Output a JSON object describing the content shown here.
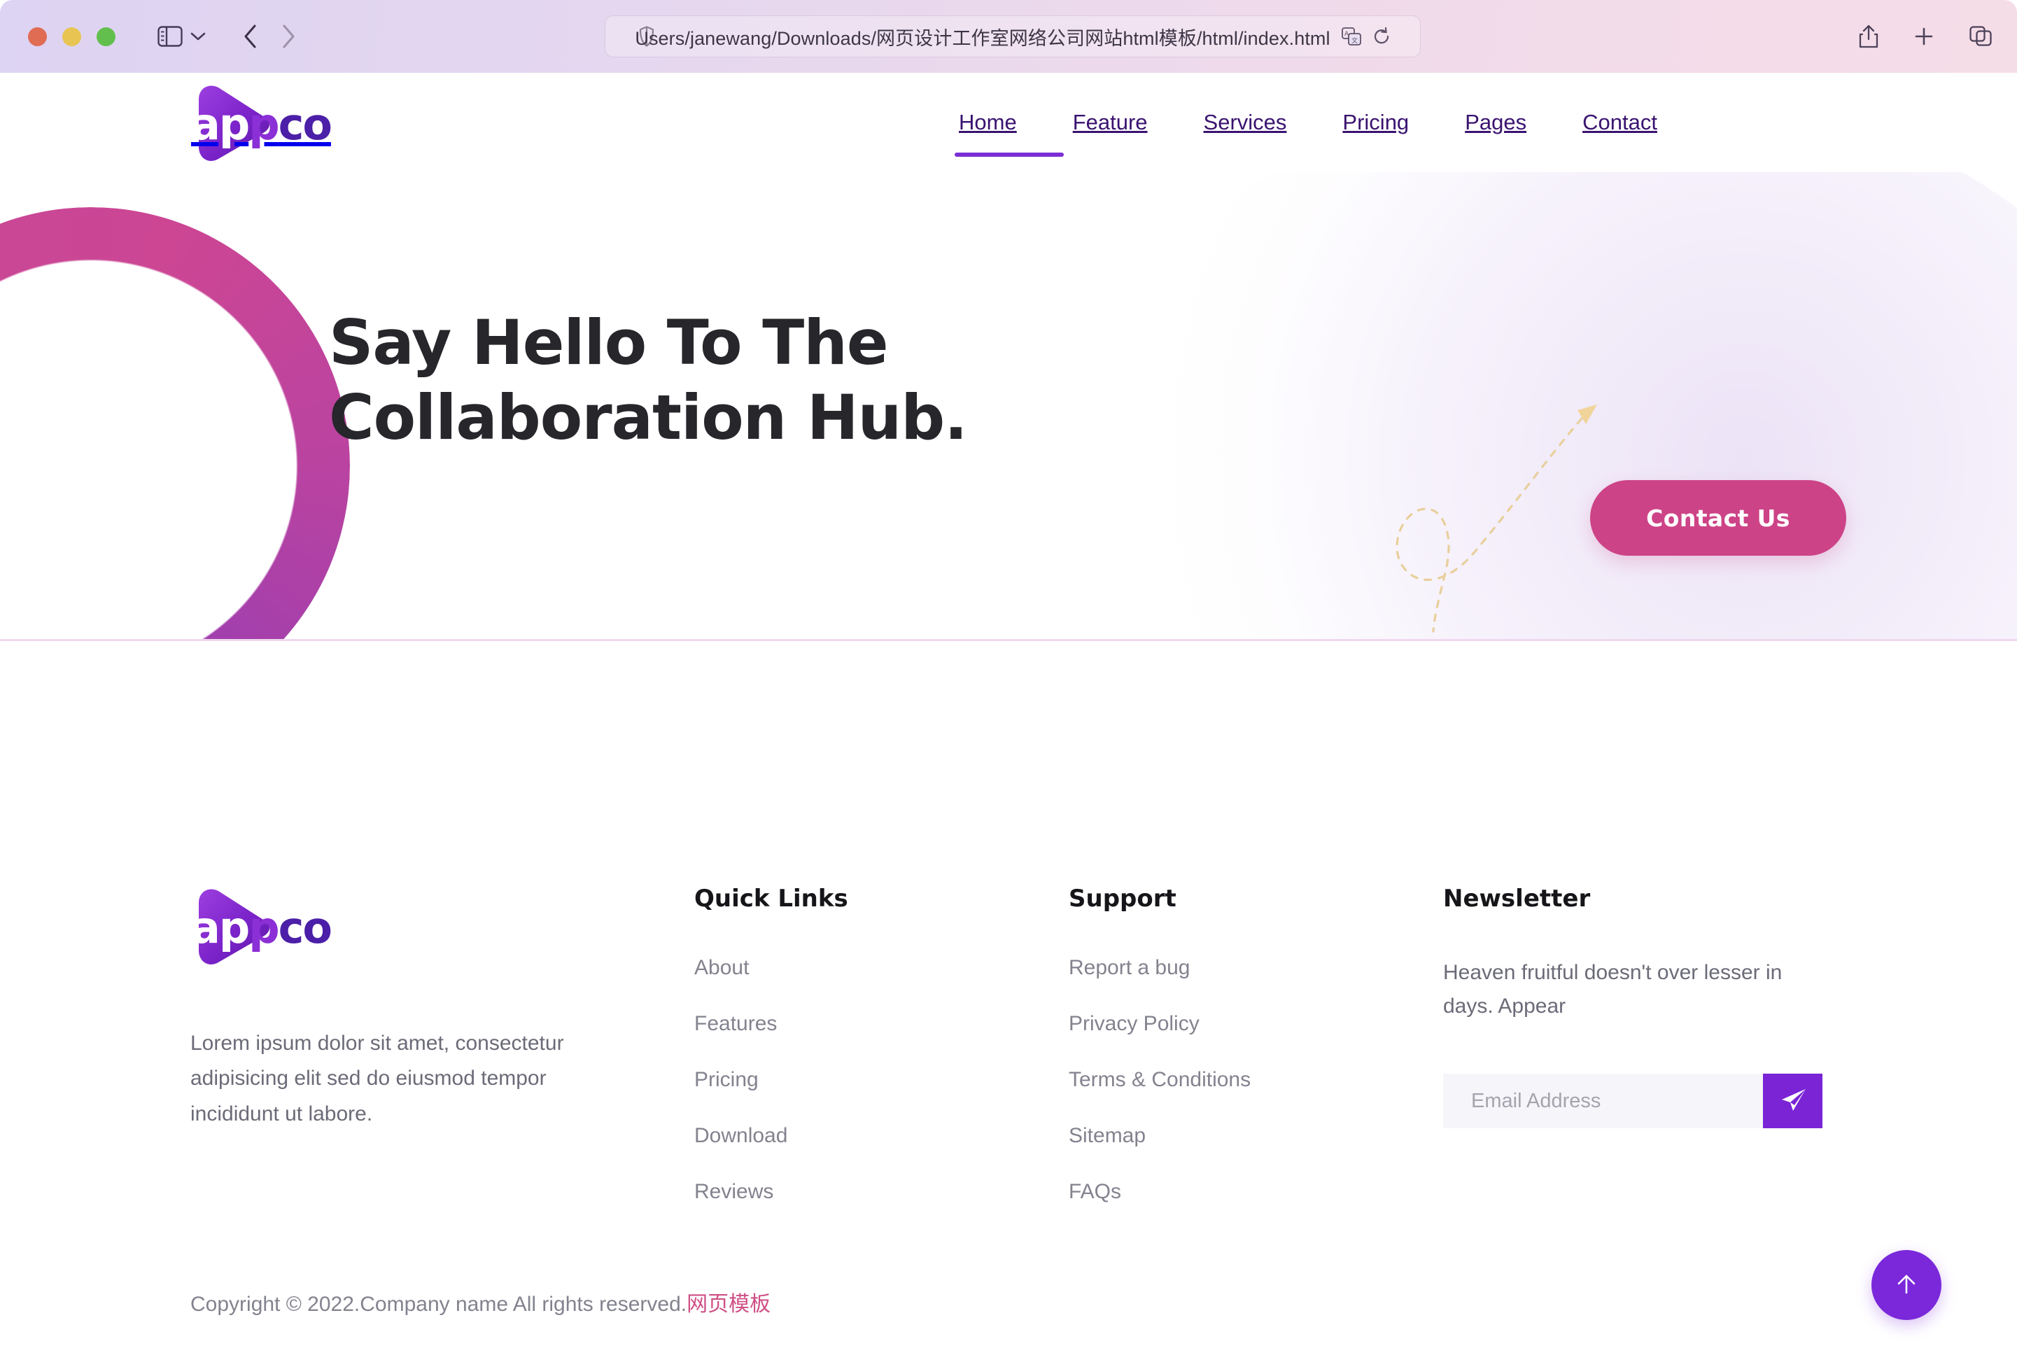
{
  "browser": {
    "url": "Users/janewang/Downloads/网页设计工作室网络公司网站html模板/html/index.html",
    "traffic_lights": [
      "close-button",
      "minimize-button",
      "maximize-button"
    ],
    "icons": {
      "sidebar": "sidebar-icon",
      "chevron_down": "chevron-down-icon",
      "back": "back-arrow-icon",
      "forward": "forward-arrow-icon",
      "shield": "shield-icon",
      "translate": "translate-icon",
      "reload": "reload-icon",
      "share": "share-icon",
      "new_tab": "plus-icon",
      "tab_overview": "tab-overview-icon"
    }
  },
  "site": {
    "logo": {
      "part1": "ap",
      "part2": "p",
      "part3": "co",
      "alt": "appco"
    },
    "nav": [
      {
        "label": "Home",
        "active": true
      },
      {
        "label": "Feature",
        "active": false
      },
      {
        "label": "Services",
        "active": false
      },
      {
        "label": "Pricing",
        "active": false
      },
      {
        "label": "Pages",
        "active": false
      },
      {
        "label": "Contact",
        "active": false
      }
    ]
  },
  "hero": {
    "title_line1": "Say Hello To The",
    "title_line2": "Collaboration Hub.",
    "cta_label": "Contact Us"
  },
  "footer": {
    "brand": {
      "description": "Lorem ipsum dolor sit amet, consectetur adipisicing elit sed do eiusmod tempor incididunt ut labore."
    },
    "quick_links": {
      "title": "Quick Links",
      "items": [
        "About",
        "Features",
        "Pricing",
        "Download",
        "Reviews"
      ]
    },
    "support": {
      "title": "Support",
      "items": [
        "Report a bug",
        "Privacy Policy",
        "Terms & Conditions",
        "Sitemap",
        "FAQs"
      ]
    },
    "newsletter": {
      "title": "Newsletter",
      "text": "Heaven fruitful doesn't over lesser in days. Appear",
      "email_placeholder": "Email Address",
      "email_value": "",
      "submit_icon": "send-icon"
    },
    "copyright_main": "Copyright © 2022.Company name All rights reserved.",
    "copyright_cn": "网页模板",
    "scroll_top_icon": "arrow-up-icon"
  },
  "colors": {
    "brand_purple": "#7a24d6",
    "nav_purple": "#3a1370",
    "accent_pink": "#cd4387",
    "footer_link": "#83838f",
    "heading_dark": "#16161a"
  }
}
